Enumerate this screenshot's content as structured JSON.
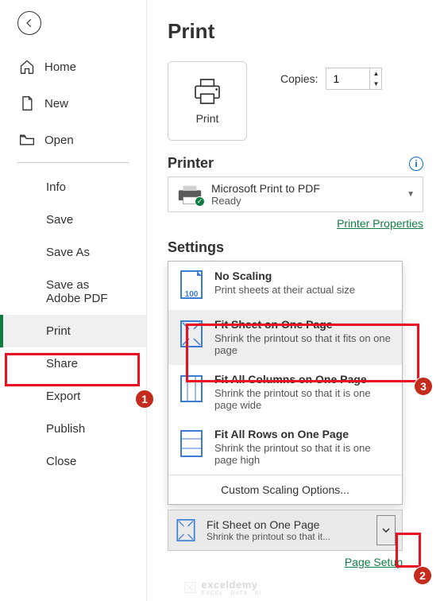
{
  "sidebar": {
    "back_aria": "Back",
    "nav": [
      {
        "label": "Home"
      },
      {
        "label": "New"
      },
      {
        "label": "Open"
      }
    ],
    "sub": [
      {
        "label": "Info"
      },
      {
        "label": "Save"
      },
      {
        "label": "Save As"
      },
      {
        "label": "Save as Adobe PDF"
      },
      {
        "label": "Print"
      },
      {
        "label": "Share"
      },
      {
        "label": "Export"
      },
      {
        "label": "Publish"
      },
      {
        "label": "Close"
      }
    ]
  },
  "main": {
    "title": "Print",
    "print_button": "Print",
    "copies_label": "Copies:",
    "copies_value": "1",
    "printer_heading": "Printer",
    "printer_name": "Microsoft Print to PDF",
    "printer_status": "Ready",
    "printer_props_link": "Printer Properties",
    "settings_heading": "Settings",
    "options": [
      {
        "title": "No Scaling",
        "desc": "Print sheets at their actual size"
      },
      {
        "title": "Fit Sheet on One Page",
        "desc": "Shrink the printout so that it fits on one page"
      },
      {
        "title": "Fit All Columns on One Page",
        "desc": "Shrink the printout so that it is one page wide"
      },
      {
        "title": "Fit All Rows on One Page",
        "desc": "Shrink the printout so that it is one page high"
      }
    ],
    "no_scaling_badge": "100",
    "custom_option": "Custom Scaling Options...",
    "current": {
      "title": "Fit Sheet on One Page",
      "desc": "Shrink the printout so that it..."
    },
    "page_setup_link": "Page Setup"
  },
  "annotations": {
    "b1": "1",
    "b2": "2",
    "b3": "3"
  },
  "watermark": {
    "brand": "exceldemy",
    "tag": "EXCEL · DATA · BI"
  }
}
